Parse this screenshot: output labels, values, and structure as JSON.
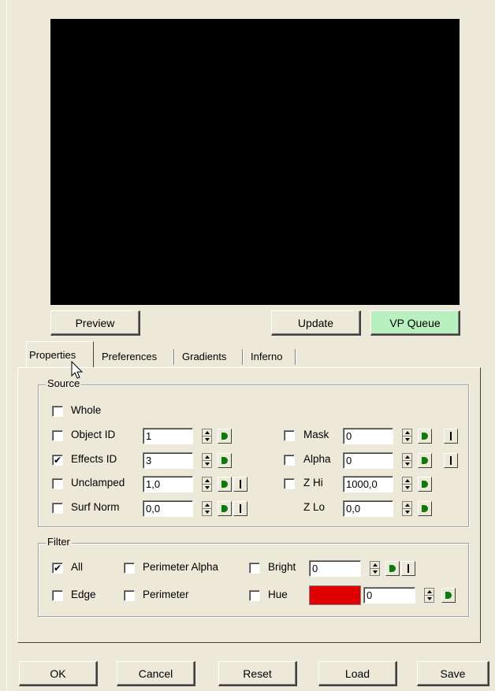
{
  "preview_buttons": {
    "preview": "Preview",
    "update": "Update",
    "vp_queue": "VP Queue"
  },
  "tabs": [
    {
      "label": "Properties",
      "active": true
    },
    {
      "label": "Preferences",
      "active": false
    },
    {
      "label": "Gradients",
      "active": false
    },
    {
      "label": "Inferno",
      "active": false
    }
  ],
  "source": {
    "group_label": "Source",
    "whole": {
      "label": "Whole",
      "checked": false
    },
    "object_id": {
      "label": "Object ID",
      "checked": false,
      "value": "1"
    },
    "effects_id": {
      "label": "Effects ID",
      "checked": true,
      "value": "3"
    },
    "unclamped": {
      "label": "Unclamped",
      "checked": false,
      "value": "1,0"
    },
    "surf_norm": {
      "label": "Surf Norm",
      "checked": false,
      "value": "0,0"
    },
    "mask": {
      "label": "Mask",
      "checked": false,
      "value": "0"
    },
    "alpha": {
      "label": "Alpha",
      "checked": false,
      "value": "0"
    },
    "z_hi": {
      "label": "Z Hi",
      "checked": false,
      "value": "1000,0"
    },
    "z_lo": {
      "label": "Z Lo",
      "value": "0,0"
    }
  },
  "filter": {
    "group_label": "Filter",
    "all": {
      "label": "All",
      "checked": true
    },
    "edge": {
      "label": "Edge",
      "checked": false
    },
    "perimeter_alpha": {
      "label": "Perimeter Alpha",
      "checked": false
    },
    "perimeter": {
      "label": "Perimeter",
      "checked": false
    },
    "bright": {
      "label": "Bright",
      "checked": false,
      "value": "0"
    },
    "hue": {
      "label": "Hue",
      "checked": false,
      "value": "0",
      "color": "#e00000"
    }
  },
  "footer": {
    "ok": "OK",
    "cancel": "Cancel",
    "reset": "Reset",
    "load": "Load",
    "save": "Save"
  },
  "check_mark": "✔"
}
